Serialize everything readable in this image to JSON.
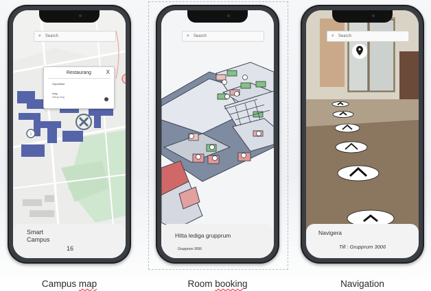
{
  "screens": [
    {
      "search_placeholder": "Search",
      "popup": {
        "title": "Restaurang",
        "close": "X",
        "line1": "Öppettider",
        "line2": "Idag",
        "line3": "Stängt idag"
      },
      "sheet": {
        "title": "Smart Campus",
        "number": "16"
      },
      "caption": {
        "first": "Campus",
        "second": "map"
      }
    },
    {
      "search_placeholder": "Search",
      "sheet": {
        "title": "Hitta lediga grupprum",
        "subtitle": "Grupprum 3006"
      },
      "caption": {
        "first": "Room",
        "second": "booking"
      }
    },
    {
      "search_placeholder": "Search",
      "sheet": {
        "title": "Navigera",
        "subtitle": "Till : Grupprum 3006"
      },
      "caption": {
        "first": "Navigation",
        "second": ""
      }
    }
  ]
}
